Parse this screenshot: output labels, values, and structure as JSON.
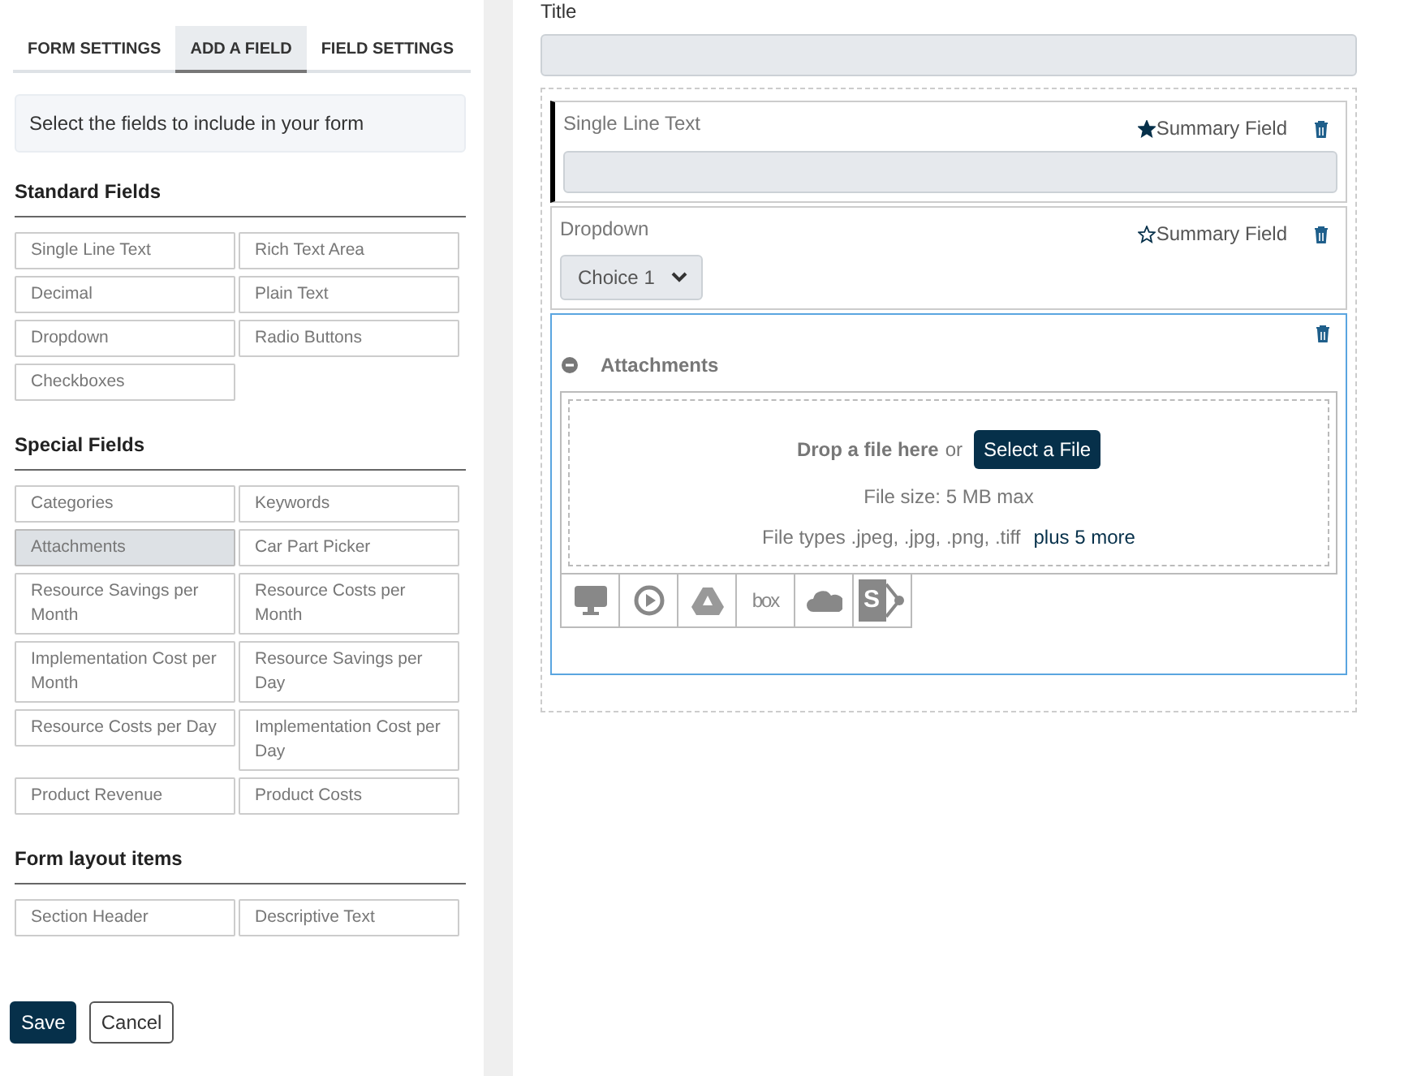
{
  "tabs": [
    {
      "label": "FORM SETTINGS",
      "selected": false
    },
    {
      "label": "ADD A FIELD",
      "selected": true
    },
    {
      "label": "FIELD SETTINGS",
      "selected": false
    }
  ],
  "hint": "Select the fields to include in your form",
  "groups": [
    {
      "title": "Standard Fields",
      "items": [
        {
          "label": "Single Line Text",
          "selected": false
        },
        {
          "label": "Rich Text Area",
          "selected": false
        },
        {
          "label": "Decimal",
          "selected": false
        },
        {
          "label": "Plain Text",
          "selected": false
        },
        {
          "label": "Dropdown",
          "selected": false
        },
        {
          "label": "Radio Buttons",
          "selected": false
        },
        {
          "label": "Checkboxes",
          "selected": false
        }
      ]
    },
    {
      "title": "Special Fields",
      "items": [
        {
          "label": "Categories",
          "selected": false
        },
        {
          "label": "Keywords",
          "selected": false
        },
        {
          "label": "Attachments",
          "selected": true
        },
        {
          "label": "Car Part Picker",
          "selected": false
        },
        {
          "label": "Resource Savings per Month",
          "selected": false
        },
        {
          "label": "Resource Costs per Month",
          "selected": false
        },
        {
          "label": "Implementation Cost per Month",
          "selected": false
        },
        {
          "label": "Resource Savings per Day",
          "selected": false
        },
        {
          "label": "Resource Costs per Day",
          "selected": false
        },
        {
          "label": "Implementation Cost per Day",
          "selected": false
        },
        {
          "label": "Product Revenue",
          "selected": false
        },
        {
          "label": "Product Costs",
          "selected": false
        }
      ]
    },
    {
      "title": "Form layout items",
      "items": [
        {
          "label": "Section Header",
          "selected": false
        },
        {
          "label": "Descriptive Text",
          "selected": false
        }
      ]
    }
  ],
  "buttons": [
    {
      "label": "Save",
      "kind": "primary"
    },
    {
      "label": "Cancel",
      "kind": "secondary"
    }
  ],
  "title_field": {
    "label": "Title"
  },
  "fields": [
    {
      "kind": "text",
      "label": "Single Line Text",
      "summary_label": "Summary Field",
      "summary": true,
      "marked": true,
      "selected": false
    },
    {
      "kind": "dropdown",
      "label": "Dropdown",
      "summary_label": "Summary Field",
      "summary": false,
      "marked": false,
      "selected": false,
      "value": "Choice 1"
    },
    {
      "kind": "attachments",
      "label": "Attachments",
      "expanded": true,
      "marked": false,
      "selected": true,
      "drop_text": "Drop a file here",
      "or_text": "or",
      "select_button": "Select a File",
      "size_text": "File size: 5 MB max",
      "types_label": "File types",
      "types": ".jpeg, .jpg, .png, .tiff",
      "more_link": "plus 5 more",
      "sources": [
        {
          "kind": "computer"
        },
        {
          "kind": "play"
        },
        {
          "kind": "drive"
        },
        {
          "kind": "box",
          "label": "box"
        },
        {
          "kind": "cloud"
        },
        {
          "kind": "sharepoint",
          "label": "S"
        }
      ]
    }
  ]
}
